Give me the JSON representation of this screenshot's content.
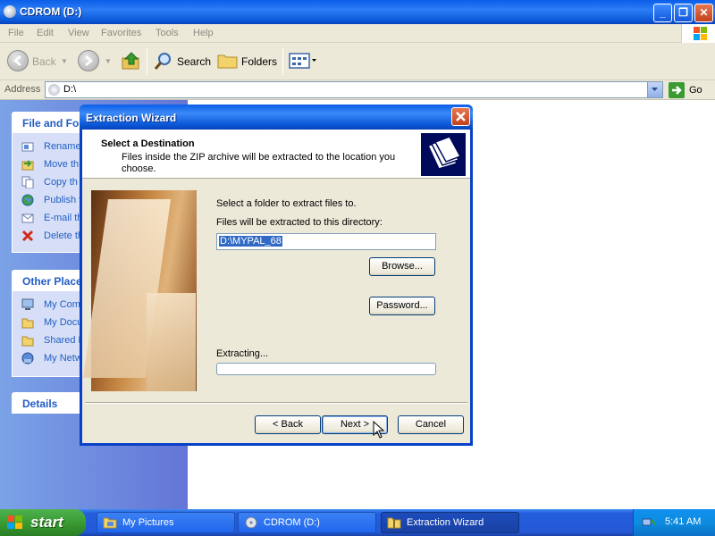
{
  "window": {
    "title": "CDROM (D:)"
  },
  "menu": [
    "File",
    "Edit",
    "View",
    "Favorites",
    "Tools",
    "Help"
  ],
  "toolbar": {
    "back": "Back",
    "search": "Search",
    "folders": "Folders"
  },
  "address": {
    "label": "Address",
    "value": "D:\\",
    "go": "Go"
  },
  "left_pane": {
    "file_tasks": {
      "title": "File and Fol",
      "items": [
        "Rename",
        "Move th",
        "Copy th",
        "Publish t",
        "E-mail th",
        "Delete th"
      ]
    },
    "other_places": {
      "title": "Other Place",
      "items": [
        "My Comp",
        "My Docu",
        "Shared D",
        "My Netw"
      ]
    },
    "details": {
      "title": "Details"
    }
  },
  "wizard": {
    "title": "Extraction Wizard",
    "heading": "Select a Destination",
    "subheading": "Files inside the ZIP archive will be extracted to the location you choose.",
    "select_label": "Select a folder to extract files to.",
    "dir_label": "Files will be extracted to this directory:",
    "destination": "D:\\MYPAL_68",
    "browse": "Browse...",
    "password": "Password...",
    "extracting": "Extracting...",
    "progress": 0,
    "back": "< Back",
    "next": "Next >",
    "cancel": "Cancel"
  },
  "taskbar": {
    "start": "start",
    "items": [
      "My Pictures",
      "CDROM (D:)",
      "Extraction Wizard"
    ],
    "active_index": 2,
    "clock": "5:41 AM"
  },
  "colors": {
    "titlebar_blue": "#0a5ee8",
    "taskbar_blue": "#245edb",
    "start_green": "#3a9b32",
    "task_link": "#215dc6"
  }
}
